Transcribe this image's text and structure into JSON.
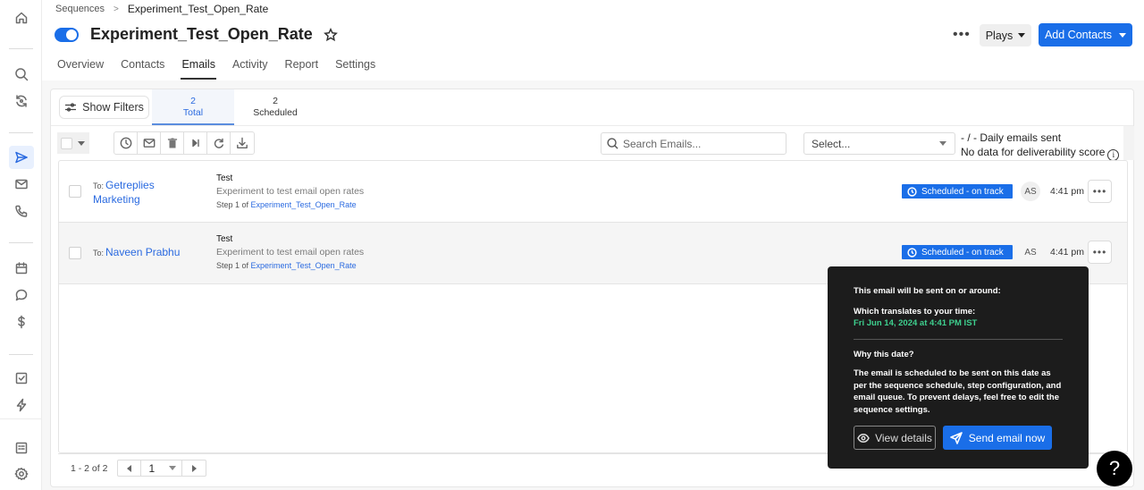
{
  "sidebar": {
    "items": [
      {
        "name": "home",
        "icon": "home-icon"
      },
      {
        "name": "search",
        "icon": "search-icon"
      },
      {
        "name": "sync",
        "icon": "sync-icon"
      },
      {
        "name": "sequences",
        "icon": "send-icon",
        "active": true
      },
      {
        "name": "email",
        "icon": "mail-icon"
      },
      {
        "name": "calls",
        "icon": "phone-icon"
      },
      {
        "name": "meetings",
        "icon": "calendar-icon"
      },
      {
        "name": "chat",
        "icon": "chat-icon"
      },
      {
        "name": "deals",
        "icon": "dollar-icon"
      },
      {
        "name": "tasks",
        "icon": "checkbox-icon"
      },
      {
        "name": "automation",
        "icon": "lightning-icon"
      },
      {
        "name": "reports",
        "icon": "list-icon"
      },
      {
        "name": "settings",
        "icon": "gear-icon"
      }
    ]
  },
  "breadcrumb": {
    "parent": "Sequences",
    "separator": ">",
    "current": "Experiment_Test_Open_Rate"
  },
  "header": {
    "title": "Experiment_Test_Open_Rate",
    "toggle_on": true,
    "more_label": "•••",
    "plays_label": "Plays",
    "add_contacts_label": "Add Contacts"
  },
  "tabs": [
    {
      "label": "Overview"
    },
    {
      "label": "Contacts"
    },
    {
      "label": "Emails",
      "active": true
    },
    {
      "label": "Activity"
    },
    {
      "label": "Report"
    },
    {
      "label": "Settings"
    }
  ],
  "toolbar": {
    "show_filters_label": "Show Filters",
    "stats": [
      {
        "count": "2",
        "label": "Total",
        "active": true
      },
      {
        "count": "2",
        "label": "Scheduled"
      }
    ],
    "search_placeholder": "Search Emails...",
    "select_placeholder": "Select...",
    "daily_emails": "- / - Daily emails sent",
    "deliverability": "No data for deliverability score",
    "info_glyph": "i"
  },
  "emails": [
    {
      "to_label": "To:",
      "recipient": "Getreplies Marketing",
      "subject": "Test",
      "preview": "Experiment to test email open rates",
      "step_prefix": "Step 1 of",
      "sequence_link": "Experiment_Test_Open_Rate",
      "status": "Scheduled - on track",
      "owner_initials": "AS",
      "time": "4:41 pm",
      "more": "•••"
    },
    {
      "to_label": "To:",
      "recipient": "Naveen Prabhu",
      "subject": "Test",
      "preview": "Experiment to test email open rates",
      "step_prefix": "Step 1 of",
      "sequence_link": "Experiment_Test_Open_Rate",
      "status": "Scheduled - on track",
      "owner_initials": "AS",
      "time": "4:41 pm",
      "more": "•••"
    }
  ],
  "pagination": {
    "range_text": "1 - 2 of 2",
    "current_page": "1"
  },
  "tooltip": {
    "line1": "This email will be sent on or around:",
    "line2": "Which translates to your time:",
    "local_time": "Fri Jun 14, 2024 at 4:41 PM IST",
    "why_heading": "Why this date?",
    "why_body": "The email is scheduled to be sent on this date as per the sequence schedule, step configuration, and email queue. To prevent delays, feel free to edit the sequence settings.",
    "view_details_label": "View details",
    "send_now_label": "Send email now"
  },
  "help": {
    "label": "?"
  },
  "colors": {
    "accent": "#1a6ee8",
    "link": "#2a6ae0",
    "tooltip_bg": "#1c1c1c",
    "tooltip_date": "#3ecf8e"
  }
}
